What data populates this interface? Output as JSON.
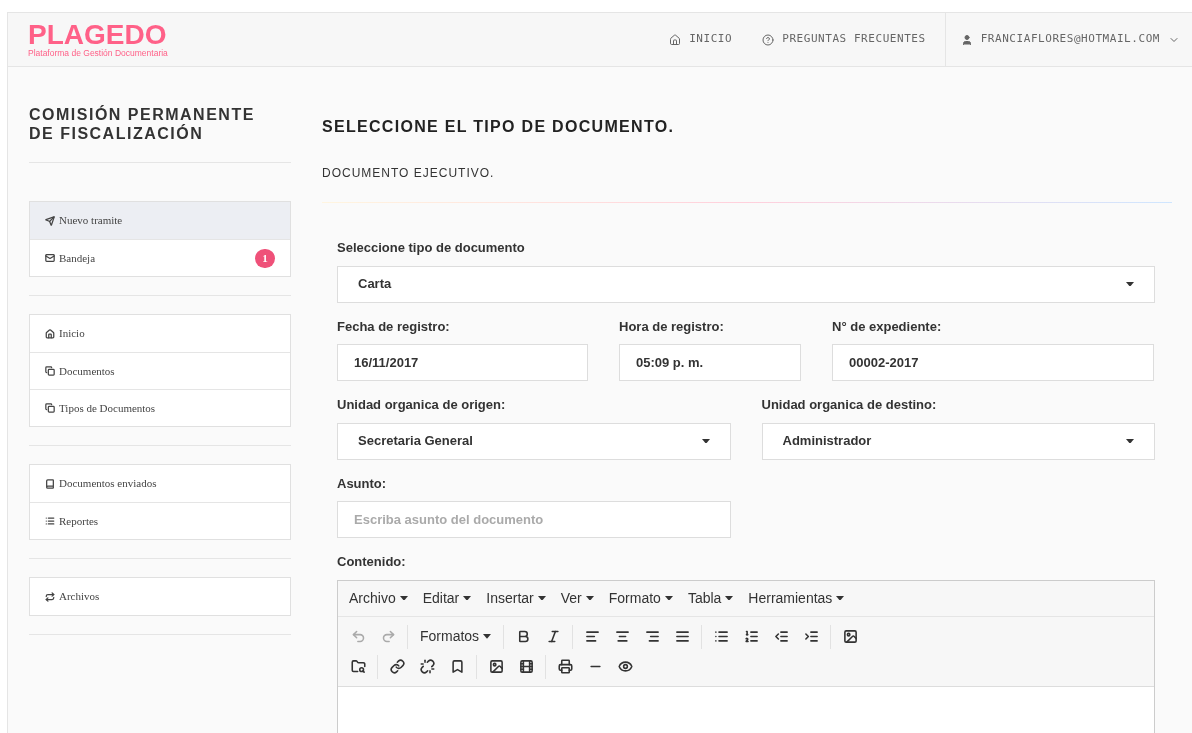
{
  "header": {
    "logo": "PLAGEDO",
    "tagline": "Plataforma de Gestión Documentaria",
    "nav": [
      "INICIO",
      "PREGUNTAS FRECUENTES"
    ],
    "user": "FRANCIAFLORES@HOTMAIL.COM"
  },
  "sidebar": {
    "title": "COMISIÓN PERMANENTE DE FISCALIZACIÓN",
    "groups": [
      [
        {
          "label": "Nuevo tramite",
          "selected": true
        },
        {
          "label": "Bandeja",
          "selected": false,
          "badge": "1"
        }
      ],
      [
        {
          "label": "Inicio",
          "selected": false
        },
        {
          "label": "Documentos",
          "selected": false
        },
        {
          "label": "Tipos de Documentos",
          "selected": false
        }
      ],
      [
        {
          "label": "Documentos enviados",
          "selected": false
        },
        {
          "label": "Reportes",
          "selected": false
        }
      ],
      [
        {
          "label": "Archivos",
          "selected": false
        }
      ]
    ]
  },
  "main": {
    "title": "SELECCIONE EL TIPO DE DOCUMENTO.",
    "subtitle": "DOCUMENTO EJECUTIVO.",
    "form": {
      "tipo": {
        "label": "Seleccione tipo de documento",
        "value": "Carta"
      },
      "fecha": {
        "label": "Fecha de registro:",
        "value": "16/11/2017"
      },
      "hora": {
        "label": "Hora de registro:",
        "value": "05:09 p. m."
      },
      "expediente": {
        "label": "N° de expediente:",
        "value": "00002-2017"
      },
      "origen": {
        "label": "Unidad organica de origen:",
        "value": "Secretaria General"
      },
      "destino": {
        "label": "Unidad organica de destino:",
        "value": "Administrador"
      },
      "asunto": {
        "label": "Asunto:",
        "placeholder": "Escriba asunto del documento"
      },
      "contenido": {
        "label": "Contenido:"
      }
    },
    "editor": {
      "menu": [
        "Archivo",
        "Editar",
        "Insertar",
        "Ver",
        "Formato",
        "Tabla",
        "Herramientas"
      ],
      "formats": "Formatos"
    }
  }
}
